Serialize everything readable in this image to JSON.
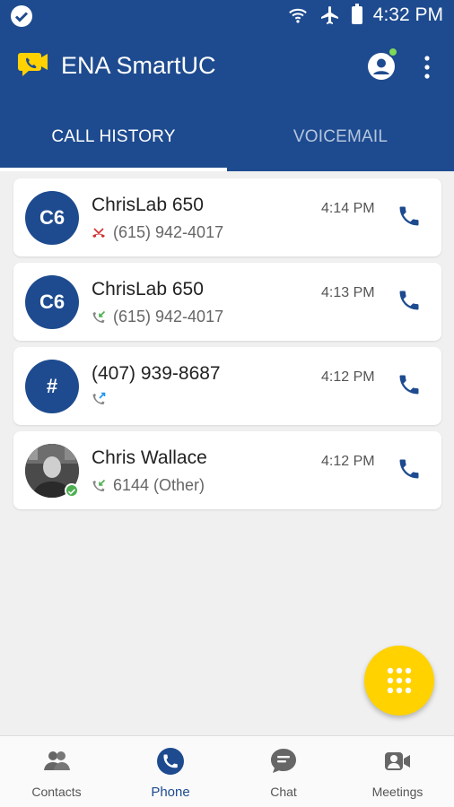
{
  "status_bar": {
    "time": "4:32 PM"
  },
  "app": {
    "title": "ENA SmartUC"
  },
  "tabs": [
    {
      "label": "CALL HISTORY",
      "active": true
    },
    {
      "label": "VOICEMAIL",
      "active": false
    }
  ],
  "calls": [
    {
      "initials": "C6",
      "name": "ChrisLab 650",
      "detail": "(615) 942-4017",
      "time": "4:14 PM",
      "direction": "missed"
    },
    {
      "initials": "C6",
      "name": "ChrisLab 650",
      "detail": "(615) 942-4017",
      "time": "4:13 PM",
      "direction": "incoming"
    },
    {
      "initials": "#",
      "name": "(407) 939-8687",
      "detail": "",
      "time": "4:12 PM",
      "direction": "outgoing"
    },
    {
      "initials": "",
      "name": "Chris Wallace",
      "detail": "6144 (Other)",
      "time": "4:12 PM",
      "direction": "incoming",
      "presence": "online"
    }
  ],
  "bottom_nav": [
    {
      "label": "Contacts",
      "icon": "contacts-icon",
      "active": false
    },
    {
      "label": "Phone",
      "icon": "phone-icon",
      "active": true
    },
    {
      "label": "Chat",
      "icon": "chat-icon",
      "active": false
    },
    {
      "label": "Meetings",
      "icon": "meetings-icon",
      "active": false
    }
  ],
  "colors": {
    "primary": "#1e4b8f",
    "accent": "#ffd200",
    "missed": "#d32f2f",
    "incoming": "#4caf50",
    "outgoing": "#2196f3",
    "presence_online": "#4caf50"
  }
}
